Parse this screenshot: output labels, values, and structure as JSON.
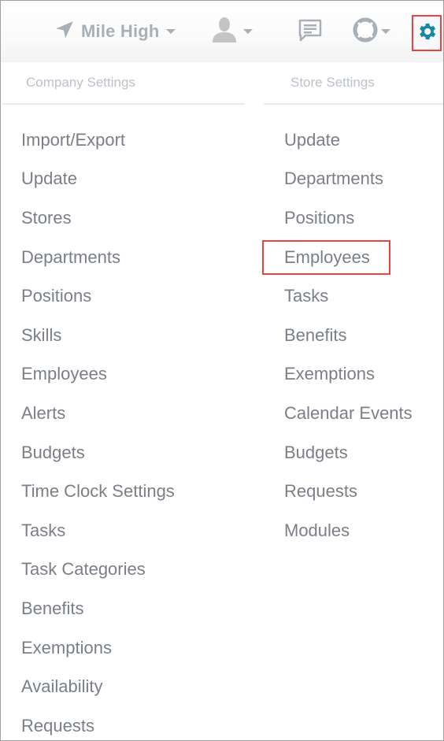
{
  "topbar": {
    "store_switcher": {
      "icon": "location-arrow-icon",
      "label": "Mile High"
    },
    "user_menu": {
      "icon": "user-avatar-icon"
    },
    "messages": {
      "icon": "message-icon"
    },
    "help_menu": {
      "icon": "lifebuoy-icon"
    },
    "settings": {
      "icon": "gear-icon",
      "highlighted": true
    }
  },
  "colors": {
    "nav_icon": "#a8afb6",
    "gear": "#1a86a6",
    "highlight_border": "#e8443c",
    "menu_text": "#7a7f87",
    "header_text": "#bcc2c8"
  },
  "dropdown": {
    "company": {
      "header": "Company Settings",
      "items": [
        {
          "label": "Import/Export"
        },
        {
          "label": "Update"
        },
        {
          "label": "Stores"
        },
        {
          "label": "Departments"
        },
        {
          "label": "Positions"
        },
        {
          "label": "Skills"
        },
        {
          "label": "Employees"
        },
        {
          "label": "Alerts"
        },
        {
          "label": "Budgets"
        },
        {
          "label": "Time Clock Settings"
        },
        {
          "label": "Tasks"
        },
        {
          "label": "Task Categories"
        },
        {
          "label": "Benefits"
        },
        {
          "label": "Exemptions"
        },
        {
          "label": "Availability"
        },
        {
          "label": "Requests"
        }
      ]
    },
    "store": {
      "header": "Store Settings",
      "items": [
        {
          "label": "Update"
        },
        {
          "label": "Departments"
        },
        {
          "label": "Positions"
        },
        {
          "label": "Employees",
          "highlighted": true
        },
        {
          "label": "Tasks"
        },
        {
          "label": "Benefits"
        },
        {
          "label": "Exemptions"
        },
        {
          "label": "Calendar Events"
        },
        {
          "label": "Budgets"
        },
        {
          "label": "Requests"
        },
        {
          "label": "Modules"
        }
      ]
    }
  }
}
